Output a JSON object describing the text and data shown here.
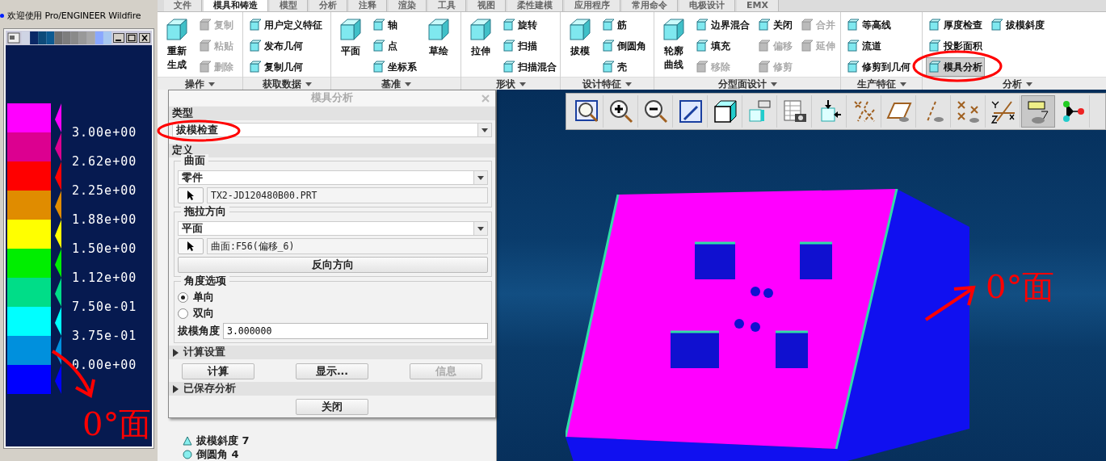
{
  "welcome": {
    "text": "欢迎使用 Pro/ENGINEER Wildfire"
  },
  "legend": {
    "bands": [
      {
        "color": "#ff00ff"
      },
      {
        "color": "#dc0090"
      },
      {
        "color": "#ff0000"
      },
      {
        "color": "#e08c00"
      },
      {
        "color": "#ffff00"
      },
      {
        "color": "#00ee00"
      },
      {
        "color": "#00dd88"
      },
      {
        "color": "#00ffff"
      },
      {
        "color": "#0090dd"
      },
      {
        "color": "#0000ff"
      }
    ],
    "labels": [
      "3.00e+00",
      "2.62e+00",
      "2.25e+00",
      "1.88e+00",
      "1.50e+00",
      "1.12e+00",
      "7.50e-01",
      "3.75e-01",
      "0.00e+00"
    ]
  },
  "tabs": [
    {
      "label": "文件",
      "selected": false
    },
    {
      "label": "模具和铸造",
      "selected": true
    },
    {
      "label": "模型",
      "selected": false
    },
    {
      "label": "分析",
      "selected": false
    },
    {
      "label": "注释",
      "selected": false
    },
    {
      "label": "渲染",
      "selected": false
    },
    {
      "label": "工具",
      "selected": false
    },
    {
      "label": "视图",
      "selected": false
    },
    {
      "label": "柔性建模",
      "selected": false
    },
    {
      "label": "应用程序",
      "selected": false
    },
    {
      "label": "常用命令",
      "selected": false
    },
    {
      "label": "电极设计",
      "selected": false
    },
    {
      "label": "EMX",
      "selected": false
    }
  ],
  "ribbon_groups": [
    {
      "label": "操作",
      "items": [
        {
          "kind": "large",
          "label": "重新生成",
          "disabled": false
        },
        {
          "kind": "small",
          "label": "复制",
          "disabled": true
        },
        {
          "kind": "small",
          "label": "粘贴",
          "disabled": true
        },
        {
          "kind": "small",
          "label": "删除",
          "disabled": true
        }
      ]
    },
    {
      "label": "获取数据",
      "items": [
        {
          "kind": "small",
          "label": "用户定义特征",
          "disabled": false
        },
        {
          "kind": "small",
          "label": "发布几何",
          "disabled": false
        },
        {
          "kind": "small",
          "label": "复制几何",
          "disabled": false
        }
      ]
    },
    {
      "label": "基准",
      "items": [
        {
          "kind": "large",
          "label": "平面",
          "disabled": false
        },
        {
          "kind": "small",
          "label": "轴",
          "disabled": false
        },
        {
          "kind": "small",
          "label": "点",
          "disabled": false
        },
        {
          "kind": "small",
          "label": "坐标系",
          "disabled": false
        },
        {
          "kind": "large",
          "label": "草绘",
          "disabled": false
        }
      ]
    },
    {
      "label": "形状",
      "items": [
        {
          "kind": "large",
          "label": "拉伸",
          "disabled": false
        },
        {
          "kind": "small",
          "label": "旋转",
          "disabled": false
        },
        {
          "kind": "small",
          "label": "扫描",
          "disabled": false
        },
        {
          "kind": "small",
          "label": "扫描混合",
          "disabled": false
        }
      ]
    },
    {
      "label": "设计特征",
      "items": [
        {
          "kind": "large",
          "label": "拔模",
          "disabled": false
        },
        {
          "kind": "small",
          "label": "筋",
          "disabled": false
        },
        {
          "kind": "small",
          "label": "倒圆角",
          "disabled": false
        },
        {
          "kind": "small",
          "label": "壳",
          "disabled": false
        }
      ]
    },
    {
      "label": "分型面设计",
      "items": [
        {
          "kind": "large",
          "label": "轮廓曲线",
          "disabled": false
        },
        {
          "kind": "small",
          "label": "边界混合",
          "disabled": false
        },
        {
          "kind": "small",
          "label": "填充",
          "disabled": false
        },
        {
          "kind": "small",
          "label": "移除",
          "disabled": true
        },
        {
          "kind": "small",
          "label": "关闭",
          "disabled": false
        },
        {
          "kind": "small",
          "label": "偏移",
          "disabled": true
        },
        {
          "kind": "small",
          "label": "修剪",
          "disabled": true
        },
        {
          "kind": "small",
          "label": "合并",
          "disabled": true
        },
        {
          "kind": "small",
          "label": "延伸",
          "disabled": true
        }
      ]
    },
    {
      "label": "生产特征",
      "items": [
        {
          "kind": "small",
          "label": "等高线",
          "disabled": false
        },
        {
          "kind": "small",
          "label": "流道",
          "disabled": false
        },
        {
          "kind": "small",
          "label": "修剪到几何",
          "disabled": false
        }
      ]
    },
    {
      "label": "分析",
      "items": [
        {
          "kind": "small",
          "label": "厚度检查",
          "disabled": false,
          "pressed": false
        },
        {
          "kind": "small",
          "label": "投影面积",
          "disabled": false,
          "pressed": false
        },
        {
          "kind": "small",
          "label": "模具分析",
          "disabled": false,
          "pressed": true
        },
        {
          "kind": "small",
          "label": "拔模斜度",
          "disabled": false,
          "pressed": false
        }
      ]
    }
  ],
  "dialog": {
    "title": "模具分析",
    "type_label": "类型",
    "type_value": "拔模检查",
    "definition_label": "定义",
    "surface_group": {
      "label": "曲面",
      "dropdown": "零件",
      "field": "TX2-JD120480B00.PRT"
    },
    "pull_group": {
      "label": "拖拉方向",
      "dropdown": "平面",
      "field": "曲面:F56(偏移_6)",
      "button": "反向方向"
    },
    "angle_group": {
      "label": "角度选项",
      "options": [
        {
          "label": "单向",
          "selected": true
        },
        {
          "label": "双向",
          "selected": false
        }
      ],
      "angle_label": "拔模角度",
      "angle_value": "3.000000"
    },
    "calc_settings": {
      "label": "计算设置",
      "expanded": false
    },
    "buttons": [
      {
        "label": "计算",
        "disabled": false
      },
      {
        "label": "显示...",
        "disabled": false
      },
      {
        "label": "信息",
        "disabled": true
      }
    ],
    "saved_analysis": {
      "label": "已保存分析",
      "expanded": false
    },
    "close_button": "关闭"
  },
  "model_tree": {
    "items": [
      {
        "label": "拔模斜度 7"
      },
      {
        "label": "倒圆角 4"
      }
    ]
  },
  "view_toolbar": {
    "buttons": [
      {
        "pressed": false
      },
      {
        "pressed": false
      },
      {
        "pressed": false
      },
      {
        "pressed": false
      },
      {
        "pressed": false
      },
      {
        "pressed": false
      },
      {
        "pressed": false
      },
      {
        "pressed": false
      },
      {
        "pressed": false
      },
      {
        "pressed": false
      },
      {
        "pressed": false
      },
      {
        "pressed": false
      },
      {
        "pressed": false
      },
      {
        "pressed": true
      },
      {
        "pressed": false
      }
    ]
  },
  "annotations": {
    "notes": [
      "0°面",
      "0°面"
    ]
  }
}
